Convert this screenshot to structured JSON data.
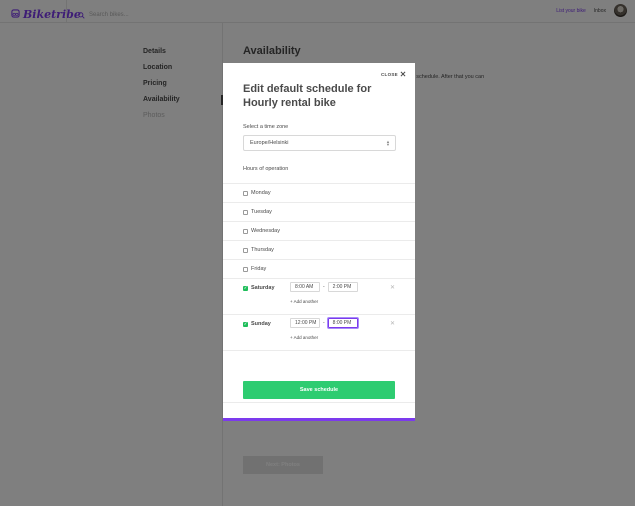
{
  "brand": {
    "name": "Biketribe",
    "color": "#7c3aed"
  },
  "header": {
    "search_placeholder": "Search bikes...",
    "list_link": "List your bike",
    "inbox_link": "Inbox"
  },
  "sidebar": {
    "items": [
      {
        "label": "Details"
      },
      {
        "label": "Location"
      },
      {
        "label": "Pricing"
      },
      {
        "label": "Availability"
      },
      {
        "label": "Photos"
      }
    ],
    "active": "Availability"
  },
  "page": {
    "heading": "Availability",
    "description_fragment": "kly schedule. After that you can",
    "next_button": "Next: Photos"
  },
  "modal": {
    "close_label": "CLOSE",
    "title": "Edit default schedule for Hourly rental bike",
    "timezone_label": "Select a time zone",
    "timezone_value": "Europe/Helsinki",
    "hours_label": "Hours of operation",
    "days": [
      {
        "name": "Monday",
        "enabled": false
      },
      {
        "name": "Tuesday",
        "enabled": false
      },
      {
        "name": "Wednesday",
        "enabled": false
      },
      {
        "name": "Thursday",
        "enabled": false
      },
      {
        "name": "Friday",
        "enabled": false
      },
      {
        "name": "Saturday",
        "enabled": true,
        "start": "8:00 AM",
        "end": "2:00 PM",
        "add_label": "+ Add another"
      },
      {
        "name": "Sunday",
        "enabled": true,
        "start": "12:00 PM",
        "end": "8:00 PM",
        "add_label": "+ Add another"
      }
    ],
    "time_separator": "-",
    "save_label": "Save schedule"
  },
  "colors": {
    "accent": "#7c3aed",
    "success": "#2ecc71",
    "checkbox_on": "#1ebd5a"
  }
}
